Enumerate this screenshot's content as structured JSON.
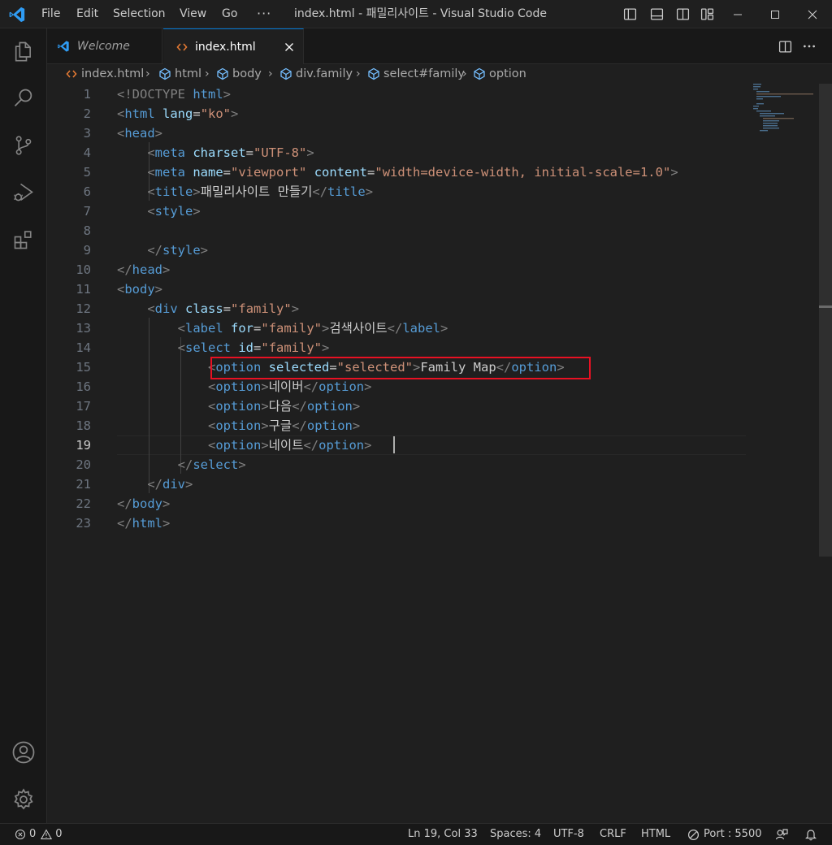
{
  "titlebar": {
    "menus": [
      "File",
      "Edit",
      "Selection",
      "View",
      "Go"
    ],
    "more": "···",
    "title": "index.html - 패밀리사이트 - Visual Studio Code"
  },
  "activitybar": {
    "items": [
      "explorer-icon",
      "search-icon",
      "source-control-icon",
      "run-debug-icon",
      "extensions-icon"
    ],
    "bottom": [
      "account-icon",
      "manage-gear-icon"
    ]
  },
  "tabs": [
    {
      "label": "Welcome",
      "active": false,
      "icon": "vscode-logo-icon"
    },
    {
      "label": "index.html",
      "active": true,
      "icon": "html-file-icon"
    }
  ],
  "breadcrumb": [
    "index.html",
    "html",
    "body",
    "div.family",
    "select#family",
    "option"
  ],
  "editor": {
    "active_line": 19,
    "lines": [
      {
        "n": "1",
        "tokens": [
          [
            "br",
            "<!DOCTYPE "
          ],
          [
            "tag",
            "html"
          ],
          [
            "br",
            ">"
          ]
        ]
      },
      {
        "n": "2",
        "tokens": [
          [
            "br",
            "<"
          ],
          [
            "tag",
            "html"
          ],
          [
            "txt",
            " "
          ],
          [
            "attr",
            "lang"
          ],
          [
            "txt",
            "="
          ],
          [
            "str",
            "\"ko\""
          ],
          [
            "br",
            ">"
          ]
        ]
      },
      {
        "n": "3",
        "tokens": [
          [
            "br",
            "<"
          ],
          [
            "tag",
            "head"
          ],
          [
            "br",
            ">"
          ]
        ]
      },
      {
        "n": "4",
        "tokens": [
          [
            "txt",
            "    "
          ],
          [
            "br",
            "<"
          ],
          [
            "tag",
            "meta"
          ],
          [
            "txt",
            " "
          ],
          [
            "attr",
            "charset"
          ],
          [
            "txt",
            "="
          ],
          [
            "str",
            "\"UTF-8\""
          ],
          [
            "br",
            ">"
          ]
        ]
      },
      {
        "n": "5",
        "tokens": [
          [
            "txt",
            "    "
          ],
          [
            "br",
            "<"
          ],
          [
            "tag",
            "meta"
          ],
          [
            "txt",
            " "
          ],
          [
            "attr",
            "name"
          ],
          [
            "txt",
            "="
          ],
          [
            "str",
            "\"viewport\""
          ],
          [
            "txt",
            " "
          ],
          [
            "attr",
            "content"
          ],
          [
            "txt",
            "="
          ],
          [
            "str",
            "\"width=device-width, initial-scale=1.0\""
          ],
          [
            "br",
            ">"
          ]
        ]
      },
      {
        "n": "6",
        "tokens": [
          [
            "txt",
            "    "
          ],
          [
            "br",
            "<"
          ],
          [
            "tag",
            "title"
          ],
          [
            "br",
            ">"
          ],
          [
            "txt",
            "패밀리사이트 만들기"
          ],
          [
            "br",
            "</"
          ],
          [
            "tag",
            "title"
          ],
          [
            "br",
            ">"
          ]
        ]
      },
      {
        "n": "7",
        "tokens": [
          [
            "txt",
            "    "
          ],
          [
            "br",
            "<"
          ],
          [
            "tag",
            "style"
          ],
          [
            "br",
            ">"
          ]
        ]
      },
      {
        "n": "8",
        "tokens": []
      },
      {
        "n": "9",
        "tokens": [
          [
            "txt",
            "    "
          ],
          [
            "br",
            "</"
          ],
          [
            "tag",
            "style"
          ],
          [
            "br",
            ">"
          ]
        ]
      },
      {
        "n": "10",
        "tokens": [
          [
            "br",
            "</"
          ],
          [
            "tag",
            "head"
          ],
          [
            "br",
            ">"
          ]
        ]
      },
      {
        "n": "11",
        "tokens": [
          [
            "br",
            "<"
          ],
          [
            "tag",
            "body"
          ],
          [
            "br",
            ">"
          ]
        ]
      },
      {
        "n": "12",
        "tokens": [
          [
            "txt",
            "    "
          ],
          [
            "br",
            "<"
          ],
          [
            "tag",
            "div"
          ],
          [
            "txt",
            " "
          ],
          [
            "attr",
            "class"
          ],
          [
            "txt",
            "="
          ],
          [
            "str",
            "\"family\""
          ],
          [
            "br",
            ">"
          ]
        ]
      },
      {
        "n": "13",
        "tokens": [
          [
            "txt",
            "        "
          ],
          [
            "br",
            "<"
          ],
          [
            "tag",
            "label"
          ],
          [
            "txt",
            " "
          ],
          [
            "attr",
            "for"
          ],
          [
            "txt",
            "="
          ],
          [
            "str",
            "\"family\""
          ],
          [
            "br",
            ">"
          ],
          [
            "txt",
            "검색사이트"
          ],
          [
            "br",
            "</"
          ],
          [
            "tag",
            "label"
          ],
          [
            "br",
            ">"
          ]
        ]
      },
      {
        "n": "14",
        "tokens": [
          [
            "txt",
            "        "
          ],
          [
            "br",
            "<"
          ],
          [
            "tag",
            "select"
          ],
          [
            "txt",
            " "
          ],
          [
            "attr",
            "id"
          ],
          [
            "txt",
            "="
          ],
          [
            "str",
            "\"family\""
          ],
          [
            "br",
            ">"
          ]
        ]
      },
      {
        "n": "15",
        "tokens": [
          [
            "txt",
            "            "
          ],
          [
            "br",
            "<"
          ],
          [
            "tag",
            "option"
          ],
          [
            "txt",
            " "
          ],
          [
            "attr",
            "selected"
          ],
          [
            "txt",
            "="
          ],
          [
            "str",
            "\"selected\""
          ],
          [
            "br",
            ">"
          ],
          [
            "txt",
            "Family Map"
          ],
          [
            "br",
            "</"
          ],
          [
            "tag",
            "option"
          ],
          [
            "br",
            ">"
          ]
        ]
      },
      {
        "n": "16",
        "tokens": [
          [
            "txt",
            "            "
          ],
          [
            "br",
            "<"
          ],
          [
            "tag",
            "option"
          ],
          [
            "br",
            ">"
          ],
          [
            "txt",
            "네이버"
          ],
          [
            "br",
            "</"
          ],
          [
            "tag",
            "option"
          ],
          [
            "br",
            ">"
          ]
        ]
      },
      {
        "n": "17",
        "tokens": [
          [
            "txt",
            "            "
          ],
          [
            "br",
            "<"
          ],
          [
            "tag",
            "option"
          ],
          [
            "br",
            ">"
          ],
          [
            "txt",
            "다음"
          ],
          [
            "br",
            "</"
          ],
          [
            "tag",
            "option"
          ],
          [
            "br",
            ">"
          ]
        ]
      },
      {
        "n": "18",
        "tokens": [
          [
            "txt",
            "            "
          ],
          [
            "br",
            "<"
          ],
          [
            "tag",
            "option"
          ],
          [
            "br",
            ">"
          ],
          [
            "txt",
            "구글"
          ],
          [
            "br",
            "</"
          ],
          [
            "tag",
            "option"
          ],
          [
            "br",
            ">"
          ]
        ]
      },
      {
        "n": "19",
        "tokens": [
          [
            "txt",
            "            "
          ],
          [
            "br",
            "<"
          ],
          [
            "tag",
            "option"
          ],
          [
            "br",
            ">"
          ],
          [
            "txt",
            "네이트"
          ],
          [
            "br",
            "</"
          ],
          [
            "tag",
            "option"
          ],
          [
            "br",
            ">"
          ]
        ]
      },
      {
        "n": "20",
        "tokens": [
          [
            "txt",
            "        "
          ],
          [
            "br",
            "</"
          ],
          [
            "tag",
            "select"
          ],
          [
            "br",
            ">"
          ]
        ]
      },
      {
        "n": "21",
        "tokens": [
          [
            "txt",
            "    "
          ],
          [
            "br",
            "</"
          ],
          [
            "tag",
            "div"
          ],
          [
            "br",
            ">"
          ]
        ]
      },
      {
        "n": "22",
        "tokens": [
          [
            "br",
            "</"
          ],
          [
            "tag",
            "body"
          ],
          [
            "br",
            ">"
          ]
        ]
      },
      {
        "n": "23",
        "tokens": [
          [
            "br",
            "</"
          ],
          [
            "tag",
            "html"
          ],
          [
            "br",
            ">"
          ]
        ]
      }
    ]
  },
  "statusbar": {
    "errors": "0",
    "warnings": "0",
    "position": "Ln 19, Col 33",
    "spaces": "Spaces: 4",
    "encoding": "UTF-8",
    "eol": "CRLF",
    "language": "HTML",
    "port": "Port : 5500"
  },
  "colors": {
    "accent": "#0078d4",
    "tag": "#569cd6",
    "attr": "#9cdcfe",
    "string": "#ce9178",
    "highlight_box": "#e81123"
  }
}
